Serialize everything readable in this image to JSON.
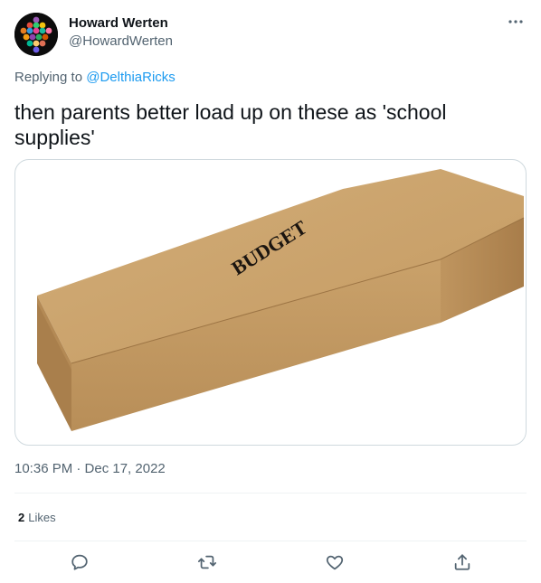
{
  "user": {
    "display_name": "Howard Werten",
    "handle": "@HowardWerten",
    "avatar_icon": "hexagon-grid-avatar"
  },
  "reply": {
    "prefix": "Replying to ",
    "target": "@DelthiaRicks"
  },
  "tweet": {
    "text": "then parents better load up on these as 'school supplies'",
    "media_label": "BUDGET",
    "timestamp": "10:36 PM · Dec 17, 2022"
  },
  "stats": {
    "likes_count": "2",
    "likes_label": "Likes"
  },
  "actions": {
    "icons": [
      "reply-icon",
      "retweet-icon",
      "like-icon",
      "share-icon"
    ]
  },
  "colors": {
    "accent": "#1d9bf0",
    "secondary_text": "#536471",
    "border": "#cfd9de",
    "cardboard": "#c9a46e"
  }
}
